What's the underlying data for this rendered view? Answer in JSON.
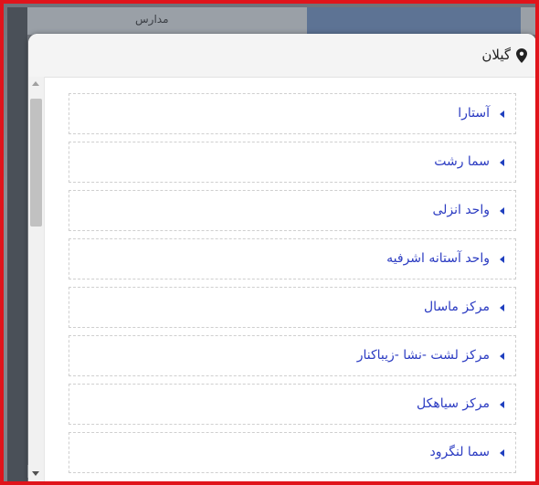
{
  "background": {
    "header_text": "مدارس",
    "tab_text": ""
  },
  "modal": {
    "title": "گیلان",
    "title_icon": "map-pin-icon",
    "items": [
      {
        "label": "آستارا",
        "icon": "caret-left-icon"
      },
      {
        "label": "سما رشت",
        "icon": "caret-left-icon"
      },
      {
        "label": "واحد انزلی",
        "icon": "caret-left-icon"
      },
      {
        "label": "واحد آستانه اشرفیه",
        "icon": "caret-left-icon"
      },
      {
        "label": "مرکز ماسال",
        "icon": "caret-left-icon"
      },
      {
        "label": "مرکز لشت -نشا -زیباکنار",
        "icon": "caret-left-icon"
      },
      {
        "label": "مرکز سیاهکل",
        "icon": "caret-left-icon"
      },
      {
        "label": "سما لنگرود",
        "icon": "caret-left-icon"
      }
    ]
  },
  "colors": {
    "frame": "#e0141b",
    "link": "#2c3cc2",
    "header_bg": "#f4f4f4"
  }
}
